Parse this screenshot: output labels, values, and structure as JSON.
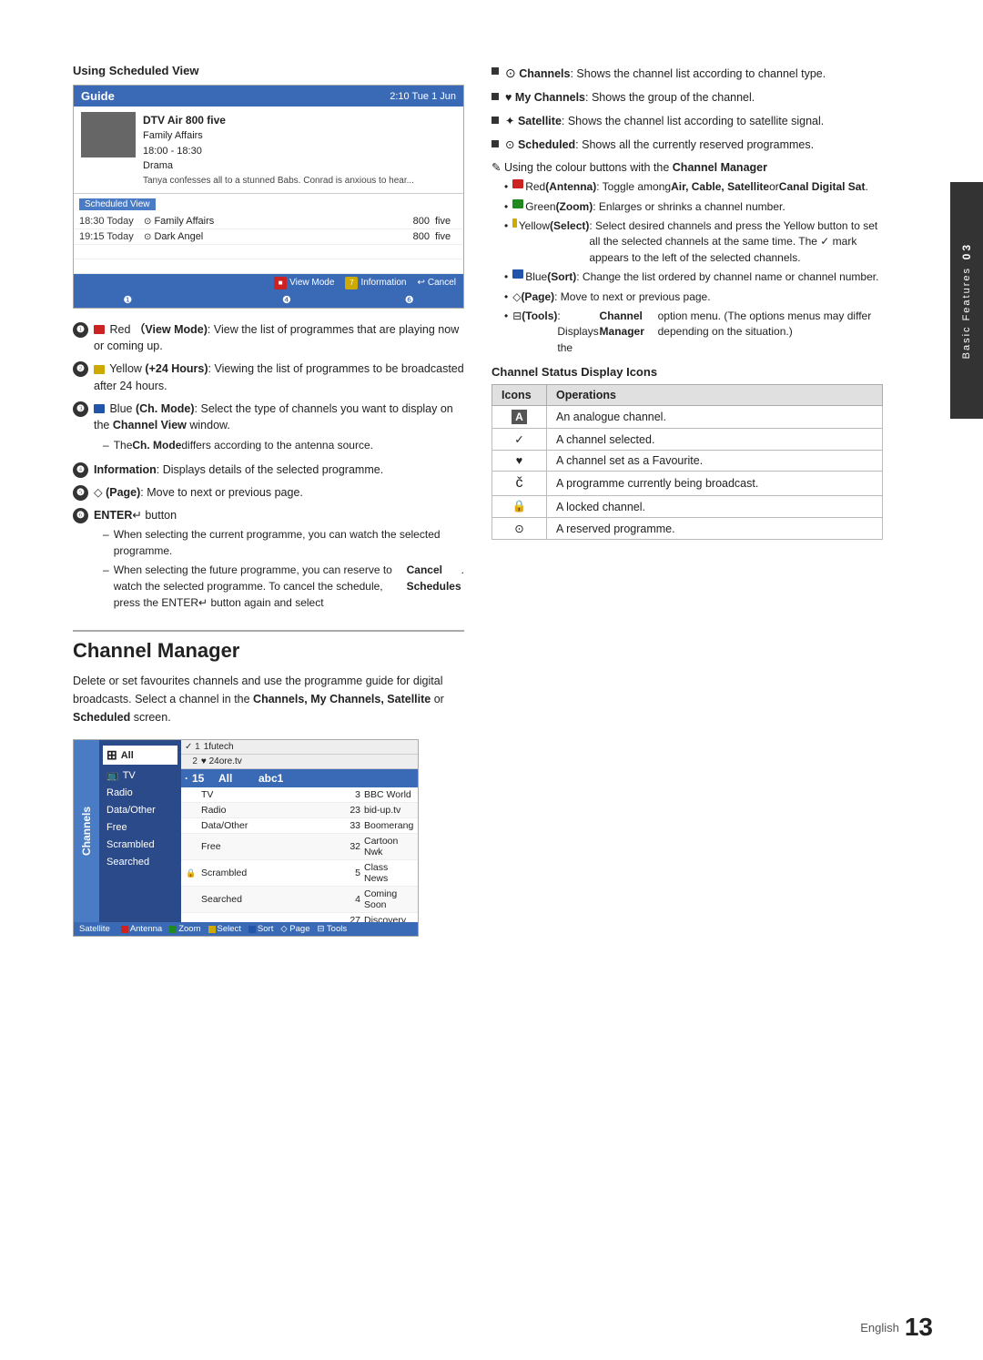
{
  "page": {
    "title": "Basic Features",
    "chapter": "03",
    "page_number": "13",
    "language": "English"
  },
  "scheduled_view": {
    "section_title": "Using Scheduled View",
    "guide": {
      "header_title": "Guide",
      "header_time": "2:10 Tue 1 Jun",
      "program_title": "DTV Air 800 five",
      "program_name": "Family Affairs",
      "program_time": "18:00 - 18:30",
      "program_genre": "Drama",
      "program_desc": "Tanya confesses all to a stunned Babs. Conrad is anxious to hear...",
      "scheduled_label": "Scheduled View",
      "rows": [
        {
          "time": "18:30 Today",
          "icon": "⊙",
          "program": "Family Affairs",
          "ch": "800",
          "qual": "five"
        },
        {
          "time": "19:15 Today",
          "icon": "⊙",
          "program": "Dark Angel",
          "ch": "800",
          "qual": "five"
        }
      ],
      "footer_buttons": [
        {
          "icon": "red",
          "label": "View Mode"
        },
        {
          "icon": "yellow",
          "label": "7 Information"
        },
        {
          "icon": "blue",
          "label": "Cancel"
        }
      ],
      "footer_numbers": [
        "1",
        "4",
        "6"
      ]
    }
  },
  "numbered_items": [
    {
      "num": "1",
      "color": "red",
      "text_before_bold": "",
      "bold_label": "Red (View Mode)",
      "text_after": ": View the list of programmes that are playing now or coming up."
    },
    {
      "num": "2",
      "color": "yellow",
      "bold_label": "Yellow (+24 Hours)",
      "text_after": ": Viewing the list of programmes to be broadcasted after 24 hours."
    },
    {
      "num": "3",
      "color": "blue",
      "bold_label": "Blue (Ch. Mode)",
      "text_after": ": Select the type of channels you want to display on the ",
      "bold_inline": "Channel View",
      "text_end": " window.",
      "sub_items": [
        "The Ch. Mode differs according to the antenna source."
      ]
    },
    {
      "num": "4",
      "bold_label": "Information",
      "text_after": ": Displays details of the selected programme."
    },
    {
      "num": "5",
      "text": "◇ (Page): Move to next or previous page."
    },
    {
      "num": "6",
      "bold_label": "ENTER",
      "text_after": " button",
      "sub_items": [
        "When selecting the current programme, you can watch the selected programme.",
        "When selecting the future programme, you can reserve to watch the selected programme. To cancel the schedule, press the ENTER button again and select Cancel Schedules."
      ]
    }
  ],
  "right_column": {
    "bullets": [
      {
        "icon": "channel",
        "text": "Channels: Shows the channel list according to channel type."
      },
      {
        "icon": "heart",
        "text": "My Channels: Shows the group of the channel."
      },
      {
        "icon": "satellite",
        "text": "Satellite: Shows the channel list according to satellite signal."
      },
      {
        "icon": "clock",
        "text": "Scheduled: Shows all the currently reserved programmes."
      }
    ],
    "colour_note": "Using the colour buttons with the Channel Manager",
    "colour_sub_items": [
      "Red (Antenna): Toggle among Air, Cable, Satellite or Canal Digital Sat.",
      "Green (Zoom): Enlarges or shrinks a channel number.",
      "Yellow (Select): Select desired channels and press the Yellow button to set all the selected channels at the same time. The ✓ mark appears to the left of the selected channels.",
      "Blue (Sort): Change the list ordered by channel name or channel number.",
      "◇ (Page): Move to next or previous page.",
      "Tools: Displays the Channel Manager option menu. (The options menus may differ depending on the situation.)"
    ],
    "channel_status_title": "Channel Status Display Icons",
    "table_headers": [
      "Icons",
      "Operations"
    ],
    "table_rows": [
      {
        "icon": "A",
        "icon_type": "letter",
        "operation": "An analogue channel."
      },
      {
        "icon": "✓",
        "icon_type": "check",
        "operation": "A channel selected."
      },
      {
        "icon": "♥",
        "icon_type": "heart",
        "operation": "A channel set as a Favourite."
      },
      {
        "icon": "č",
        "icon_type": "broadcast",
        "operation": "A programme currently being broadcast."
      },
      {
        "icon": "🔒",
        "icon_type": "lock",
        "operation": "A locked channel."
      },
      {
        "icon": "⊙",
        "icon_type": "reserved",
        "operation": "A reserved programme."
      }
    ]
  },
  "channel_manager": {
    "title": "Channel Manager",
    "description": "Delete or set favourites channels and use the programme guide for digital broadcasts. Select a channel in the Channels, My Channels, Satellite or Scheduled screen.",
    "ui": {
      "sidebar_label": "Channels",
      "satellite_label": "Satellite",
      "nav_items": [
        {
          "icon": "tv",
          "label": "TV"
        },
        {
          "icon": "radio",
          "label": "Radio"
        },
        {
          "icon": "data",
          "label": "Data/Other"
        },
        {
          "icon": "free",
          "label": "Free"
        },
        {
          "icon": "scrambled",
          "label": "Scrambled"
        },
        {
          "icon": "searched",
          "label": "Searched"
        }
      ],
      "header": {
        "check": "✓ 1",
        "num": "2",
        "name": "1futech",
        "name2": "♥ 24ore.tv"
      },
      "selected_row": {
        "dot": "·",
        "num": "15",
        "label": "All",
        "name": "abc1"
      },
      "rows": [
        {
          "icon": "",
          "name": "TV",
          "num": "3",
          "val": "BBC World"
        },
        {
          "icon": "",
          "name": "Radio",
          "num": "23",
          "val": "bid-up.tv"
        },
        {
          "icon": "",
          "name": "Data/Other",
          "num": "33",
          "val": "Boomerang"
        },
        {
          "icon": "",
          "name": "Free",
          "num": "32",
          "val": "Cartoon Nwk"
        },
        {
          "icon": "",
          "name": "Scrambled",
          "num": "5",
          "val": "Class News"
        },
        {
          "icon": "",
          "name": "Searched",
          "num": "4",
          "val": "Coming Soon"
        },
        {
          "icon": "",
          "name": "",
          "num": "27",
          "val": "Discovery"
        }
      ],
      "footer_items": [
        {
          "color": "red",
          "label": "Antenna"
        },
        {
          "color": "green",
          "label": "Zoom"
        },
        {
          "color": "yellow",
          "label": "Select"
        },
        {
          "color": "blue",
          "label": "Sort"
        },
        {
          "label": "◇ Page"
        },
        {
          "label": "Tools"
        }
      ]
    }
  },
  "footer": {
    "language": "English",
    "page_number": "13"
  }
}
